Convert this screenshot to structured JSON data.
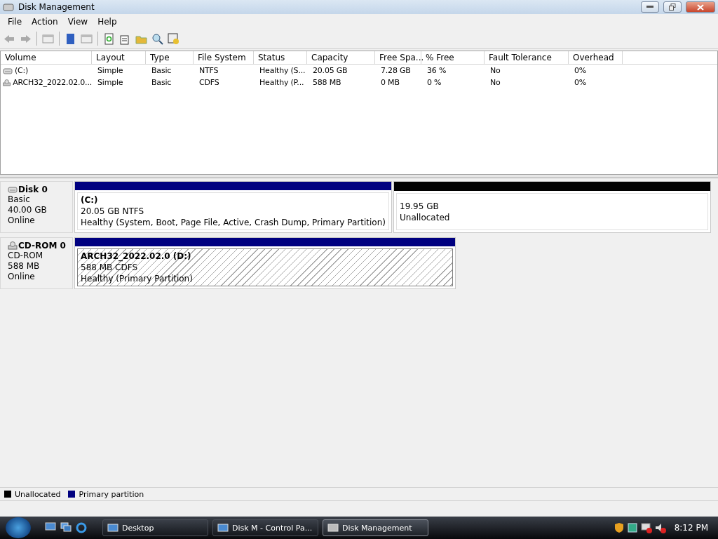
{
  "window": {
    "title": "Disk Management"
  },
  "menu": [
    "File",
    "Action",
    "View",
    "Help"
  ],
  "table": {
    "columns": [
      "Volume",
      "Layout",
      "Type",
      "File System",
      "Status",
      "Capacity",
      "Free Spa...",
      "% Free",
      "Fault Tolerance",
      "Overhead"
    ],
    "rows": [
      {
        "kind": "hdd",
        "cells": [
          "(C:)",
          "Simple",
          "Basic",
          "NTFS",
          "Healthy (S...",
          "20.05 GB",
          "7.28 GB",
          "36 %",
          "No",
          "0%"
        ]
      },
      {
        "kind": "cd",
        "cells": [
          "ARCH32_2022.02.0...",
          "Simple",
          "Basic",
          "CDFS",
          "Healthy (P...",
          "588 MB",
          "0 MB",
          "0 %",
          "No",
          "0%"
        ]
      }
    ]
  },
  "disks": [
    {
      "kind": "hdd",
      "name": "Disk 0",
      "lines": [
        "Basic",
        "40.00 GB",
        "Online"
      ],
      "partitions": [
        {
          "kind": "primary",
          "selected": false,
          "title": "(C:)",
          "lines": [
            "20.05 GB NTFS",
            "Healthy (System, Boot, Page File, Active, Crash Dump, Primary Partition)"
          ]
        },
        {
          "kind": "unallocated",
          "selected": false,
          "lines": [
            "19.95 GB",
            "Unallocated"
          ]
        }
      ]
    },
    {
      "kind": "cd",
      "name": "CD-ROM 0",
      "lines": [
        "CD-ROM",
        "588 MB",
        "Online"
      ],
      "partitions": [
        {
          "kind": "primary",
          "selected": true,
          "title": "ARCH32_2022.02.0  (D:)",
          "lines": [
            "588 MB CDFS",
            "Healthy (Primary Partition)"
          ]
        }
      ]
    }
  ],
  "legend": [
    {
      "label": "Unallocated",
      "color": "#000000"
    },
    {
      "label": "Primary partition",
      "color": "#000080"
    }
  ],
  "taskbar": {
    "windows": [
      {
        "label": "Desktop",
        "selected": false
      },
      {
        "label": "Disk M - Control Pa...",
        "selected": false
      },
      {
        "label": "Disk Management",
        "selected": true
      }
    ],
    "clock": "8:12 PM"
  }
}
